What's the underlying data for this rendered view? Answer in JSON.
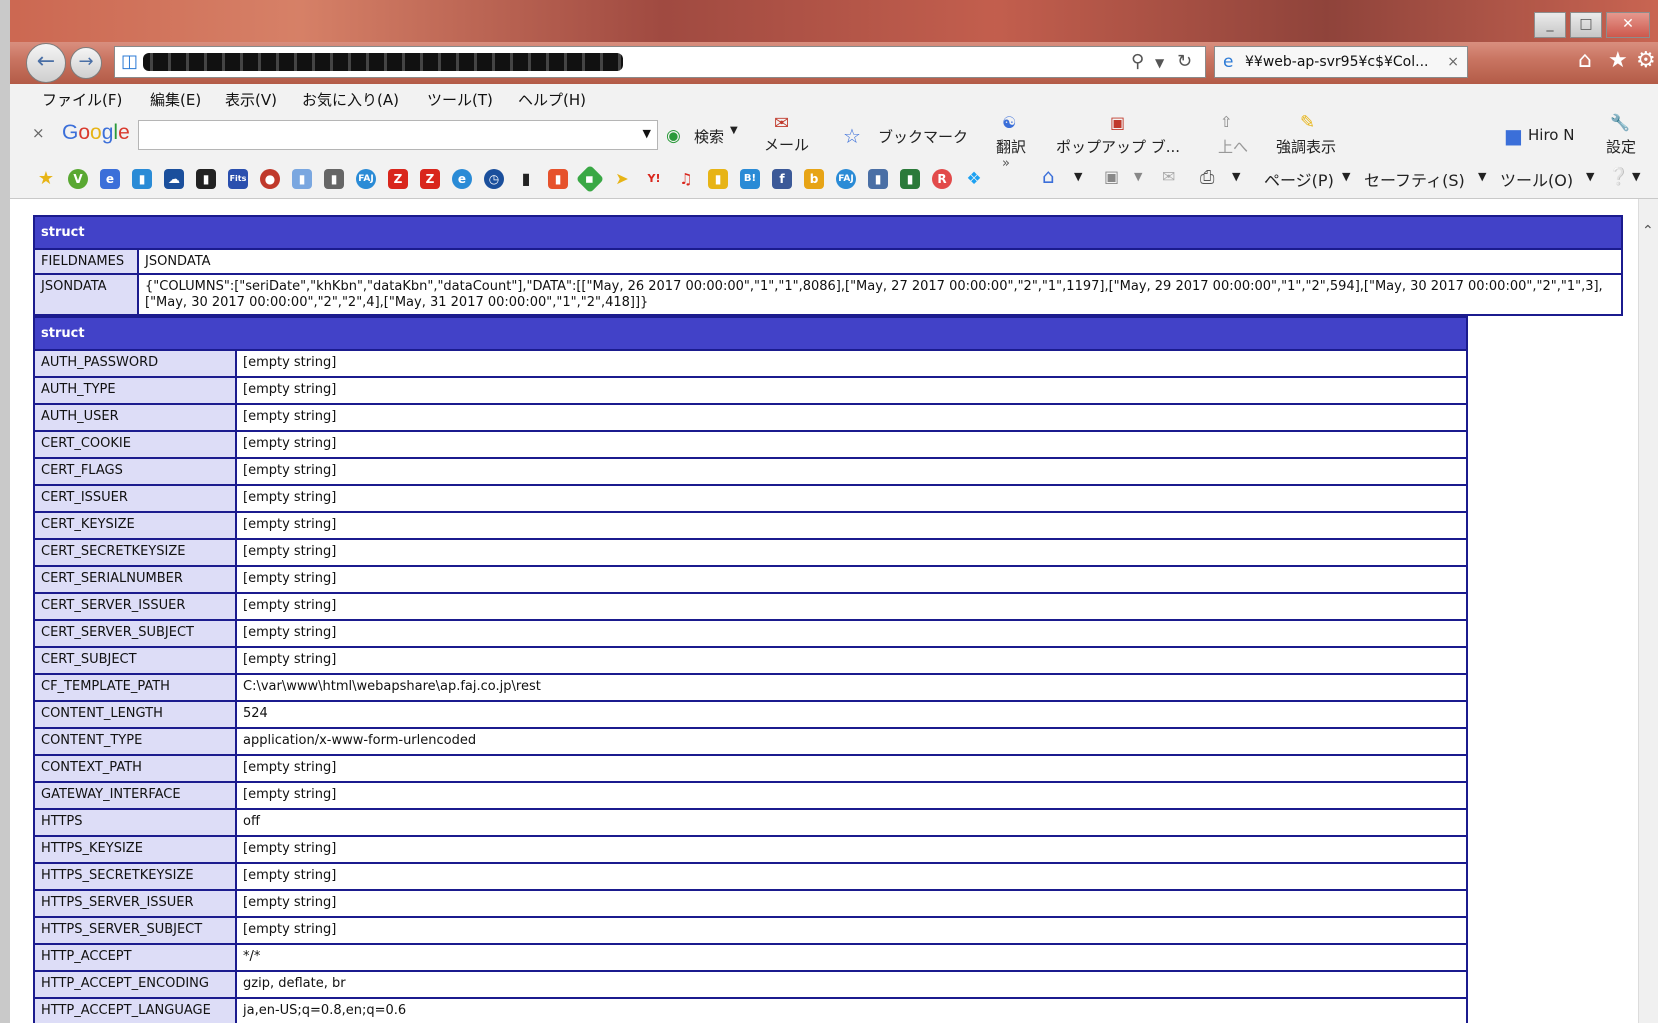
{
  "window": {
    "minimize": "_",
    "maximize": "□",
    "close": "✕"
  },
  "nav": {
    "back_icon": "arrow-left-icon",
    "forward_icon": "arrow-right-icon",
    "tab_title": "¥¥web-ap-svr95¥c$¥Col...",
    "tab_close": "×"
  },
  "menu": [
    "ファイル(F)",
    "編集(E)",
    "表示(V)",
    "お気に入り(A)",
    "ツール(T)",
    "ヘルプ(H)"
  ],
  "google_toolbar": {
    "close": "×",
    "logo": "Google",
    "search_label": "検索",
    "mail_label": "メール",
    "bookmark_label": "ブックマーク",
    "translate_label": "翻訳",
    "popup_label": "ポップアップ ブ...",
    "up_label": "上へ",
    "highlight_label": "強調表示",
    "user_label": "Hiro N",
    "settings_label": "設定"
  },
  "command_bar": {
    "more": "»",
    "page_label": "ページ(P)",
    "safety_label": "セーフティ(S)",
    "tools_label": "ツール(O)"
  },
  "dump": {
    "struct1_header": "struct",
    "struct1_rows": [
      {
        "key": "FIELDNAMES",
        "value": "JSONDATA"
      },
      {
        "key": "JSONDATA",
        "value": "{\"COLUMNS\":[\"seriDate\",\"khKbn\",\"dataKbn\",\"dataCount\"],\"DATA\":[[\"May, 26 2017 00:00:00\",\"1\",\"1\",8086],[\"May, 27 2017 00:00:00\",\"2\",\"1\",1197],[\"May, 29 2017 00:00:00\",\"1\",\"2\",594],[\"May, 30 2017 00:00:00\",\"2\",\"1\",3],[\"May, 30 2017 00:00:00\",\"2\",\"2\",4],[\"May, 31 2017 00:00:00\",\"1\",\"2\",418]]}"
      }
    ],
    "struct2_header": "struct",
    "struct2_rows": [
      {
        "key": "AUTH_PASSWORD",
        "value": "[empty string]"
      },
      {
        "key": "AUTH_TYPE",
        "value": "[empty string]"
      },
      {
        "key": "AUTH_USER",
        "value": "[empty string]"
      },
      {
        "key": "CERT_COOKIE",
        "value": "[empty string]"
      },
      {
        "key": "CERT_FLAGS",
        "value": "[empty string]"
      },
      {
        "key": "CERT_ISSUER",
        "value": "[empty string]"
      },
      {
        "key": "CERT_KEYSIZE",
        "value": "[empty string]"
      },
      {
        "key": "CERT_SECRETKEYSIZE",
        "value": "[empty string]"
      },
      {
        "key": "CERT_SERIALNUMBER",
        "value": "[empty string]"
      },
      {
        "key": "CERT_SERVER_ISSUER",
        "value": "[empty string]"
      },
      {
        "key": "CERT_SERVER_SUBJECT",
        "value": "[empty string]"
      },
      {
        "key": "CERT_SUBJECT",
        "value": "[empty string]"
      },
      {
        "key": "CF_TEMPLATE_PATH",
        "value": "C:\\var\\www\\html\\webapshare\\ap.faj.co.jp\\rest"
      },
      {
        "key": "CONTENT_LENGTH",
        "value": "524"
      },
      {
        "key": "CONTENT_TYPE",
        "value": "application/x-www-form-urlencoded"
      },
      {
        "key": "CONTEXT_PATH",
        "value": "[empty string]"
      },
      {
        "key": "GATEWAY_INTERFACE",
        "value": "[empty string]"
      },
      {
        "key": "HTTPS",
        "value": "off"
      },
      {
        "key": "HTTPS_KEYSIZE",
        "value": "[empty string]"
      },
      {
        "key": "HTTPS_SECRETKEYSIZE",
        "value": "[empty string]"
      },
      {
        "key": "HTTPS_SERVER_ISSUER",
        "value": "[empty string]"
      },
      {
        "key": "HTTPS_SERVER_SUBJECT",
        "value": "[empty string]"
      },
      {
        "key": "HTTP_ACCEPT",
        "value": "*/*"
      },
      {
        "key": "HTTP_ACCEPT_ENCODING",
        "value": "gzip, deflate, br"
      },
      {
        "key": "HTTP_ACCEPT_LANGUAGE",
        "value": "ja,en-US;q=0.8,en;q=0.6"
      }
    ]
  },
  "colors": {
    "header_bg": "#4242c8",
    "border": "#1b1b8e",
    "key_bg": "#ddddf7"
  }
}
